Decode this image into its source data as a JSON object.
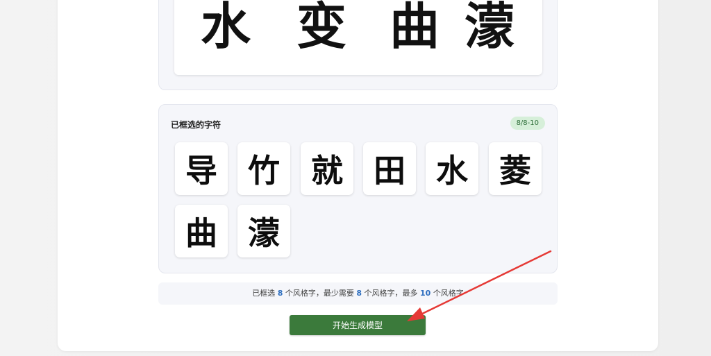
{
  "preview": {
    "glyphs": [
      "水",
      "变",
      "曲",
      "濛"
    ]
  },
  "selected": {
    "title": "已框选的字符",
    "count_badge": "8/8-10",
    "chars": [
      "导",
      "竹",
      "就",
      "田",
      "水",
      "菱",
      "曲",
      "濛"
    ]
  },
  "info": {
    "prefix": "已框选",
    "selected_count": "8",
    "mid1": "个风格字，最少需要",
    "min_count": "8",
    "mid2": "个风格字，最多",
    "max_count": "10",
    "suffix": "个风格字"
  },
  "actions": {
    "start_label": "开始生成模型"
  },
  "colors": {
    "button": "#3b7a3b",
    "badge_bg": "#d6efd9",
    "number_highlight": "#2f6fbf",
    "arrow": "#e53935"
  }
}
